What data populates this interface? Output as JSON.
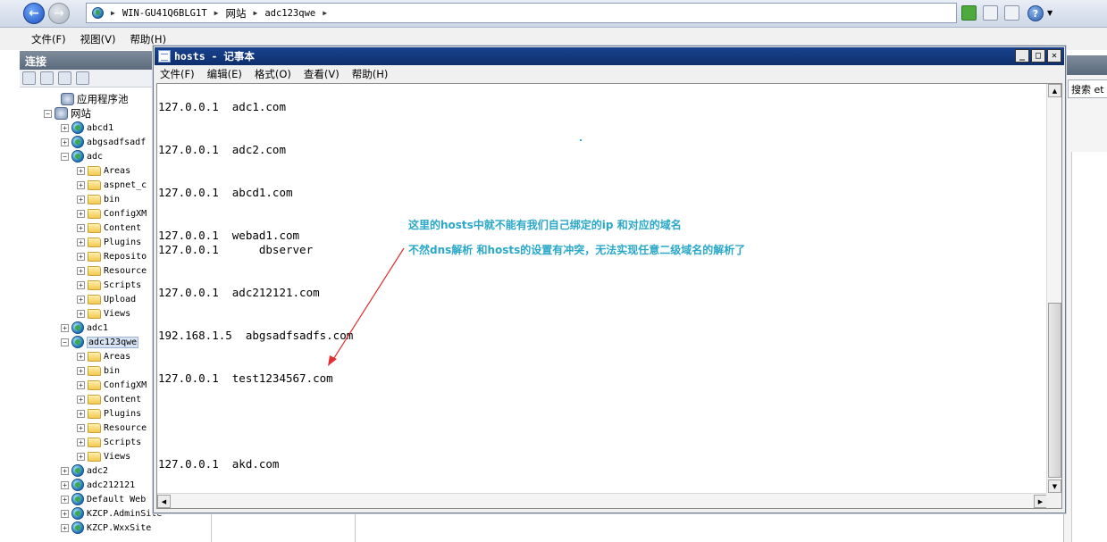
{
  "address_bar": {
    "segments": [
      "WIN-GU41Q6BLG1T",
      "网站",
      "adc123qwe"
    ]
  },
  "iis_menu": {
    "file": "文件(F)",
    "view": "视图(V)",
    "help": "帮助(H)"
  },
  "connections": {
    "title": "连接",
    "tree": [
      {
        "label": "应用程序池",
        "indent": 0,
        "icon": "app-pool-icon"
      },
      {
        "label": "网站",
        "indent": 0,
        "icon": "sites-icon",
        "expanded": true
      },
      {
        "label": "abcd1",
        "icon": "site-globe-icon",
        "expanded": false
      },
      {
        "label": "abgsadfsadf",
        "icon": "site-globe-icon",
        "expanded": false
      },
      {
        "label": "adc",
        "icon": "site-globe-icon",
        "expanded": true
      },
      {
        "label": "Areas",
        "icon": "folder-icon"
      },
      {
        "label": "aspnet_c",
        "icon": "folder-icon"
      },
      {
        "label": "bin",
        "icon": "folder-icon"
      },
      {
        "label": "ConfigXM",
        "icon": "folder-icon"
      },
      {
        "label": "Content",
        "icon": "folder-icon"
      },
      {
        "label": "Plugins",
        "icon": "folder-icon"
      },
      {
        "label": "Reposito",
        "icon": "folder-icon"
      },
      {
        "label": "Resource",
        "icon": "folder-icon"
      },
      {
        "label": "Scripts",
        "icon": "folder-icon"
      },
      {
        "label": "Upload",
        "icon": "folder-icon"
      },
      {
        "label": "Views",
        "icon": "folder-icon"
      },
      {
        "label": "adc1",
        "icon": "site-globe-icon",
        "expanded": false
      },
      {
        "label": "adc123qwe",
        "icon": "site-globe-icon",
        "expanded": true,
        "selected": true
      },
      {
        "label": "Areas",
        "icon": "folder-icon"
      },
      {
        "label": "bin",
        "icon": "folder-icon"
      },
      {
        "label": "ConfigXM",
        "icon": "folder-icon"
      },
      {
        "label": "Content",
        "icon": "folder-icon"
      },
      {
        "label": "Plugins",
        "icon": "folder-icon"
      },
      {
        "label": "Resource",
        "icon": "folder-icon"
      },
      {
        "label": "Scripts",
        "icon": "folder-icon"
      },
      {
        "label": "Views",
        "icon": "folder-icon"
      },
      {
        "label": "adc2",
        "icon": "site-globe-icon",
        "expanded": false
      },
      {
        "label": "adc212121",
        "icon": "site-globe-icon",
        "expanded": false
      },
      {
        "label": "Default Web Site",
        "icon": "site-globe-icon",
        "expanded": false
      },
      {
        "label": "KZCP.AdminSite",
        "icon": "site-globe-icon",
        "expanded": false
      },
      {
        "label": "KZCP.WxxSite",
        "icon": "site-globe-icon",
        "expanded": false
      }
    ]
  },
  "right_pane": {
    "search_label": "搜索 et"
  },
  "notepad": {
    "title": "hosts - 记事本",
    "menu": [
      "文件(F)",
      "编辑(E)",
      "格式(O)",
      "查看(V)",
      "帮助(H)"
    ],
    "lines": [
      "127.0.0.1  adc1.com",
      "127.0.0.1  adc2.com",
      "127.0.0.1  abcd1.com",
      "127.0.0.1  webad1.com",
      "127.0.0.1      dbserver",
      "127.0.0.1  adc212121.com",
      "192.168.1.5  abgsadfsadfs.com",
      "127.0.0.1  test1234567.com",
      "127.0.0.1  akd.com"
    ]
  },
  "annotation": {
    "line1": "这里的hosts中就不能有我们自己绑定的ip 和对应的域名",
    "line2": "不然dns解析 和hosts的设置有冲突，无法实现任意二级域名的解析了",
    "arrow_color": "#e03030",
    "text_color": "#2aa8c8"
  }
}
